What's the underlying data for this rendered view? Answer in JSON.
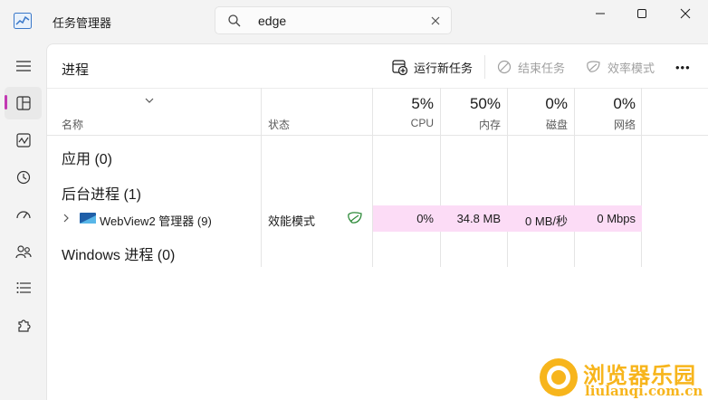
{
  "titlebar": {
    "title": "任务管理器",
    "search_value": "edge"
  },
  "nav": {
    "items": [
      "hamburger",
      "processes",
      "performance",
      "app-history",
      "startup-apps",
      "users",
      "details",
      "services"
    ]
  },
  "toolbar": {
    "page_title": "进程",
    "run_new_task": "运行新任务",
    "end_task": "结束任务",
    "efficiency_mode": "效率模式",
    "more": "•••"
  },
  "table": {
    "header": {
      "name": "名称",
      "status": "状态",
      "cpu_pct": "5%",
      "cpu_label": "CPU",
      "mem_pct": "50%",
      "mem_label": "内存",
      "disk_pct": "0%",
      "disk_label": "磁盘",
      "net_pct": "0%",
      "net_label": "网络"
    },
    "groups": {
      "apps": "应用 (0)",
      "background": "后台进程 (1)",
      "windows": "Windows 进程 (0)"
    },
    "rows": [
      {
        "name": "WebView2 管理器 (9)",
        "status": "效能模式",
        "cpu": "0%",
        "memory": "34.8 MB",
        "disk": "0 MB/秒",
        "network": "0 Mbps"
      }
    ]
  },
  "watermark": {
    "title": "浏览器乐园",
    "url": "liulanqi.com.cn"
  },
  "colors": {
    "accent": "#c239b3",
    "highlight_row": "#fcdcf6",
    "leaf_green": "#2e8b3a"
  }
}
